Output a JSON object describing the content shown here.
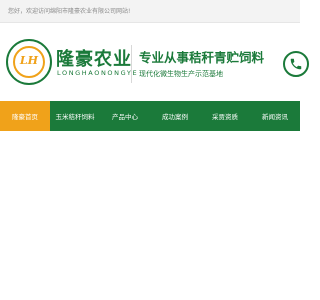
{
  "topbar": {
    "welcome": "您好，欢迎访问绵阳市隆豪农业有限公司网站!"
  },
  "brand": {
    "name_cn": "隆豪农业",
    "name_en": "LONGHAONONGYE",
    "logo_mark": "LH"
  },
  "slogan": {
    "main": "专业从事秸秆青贮饲料",
    "sub": "现代化微生物生产示范基地"
  },
  "nav": {
    "items": [
      {
        "label": "隆豪首页",
        "active": true
      },
      {
        "label": "玉米秸秆饲料",
        "active": false
      },
      {
        "label": "产品中心",
        "active": false
      },
      {
        "label": "成功案例",
        "active": false
      },
      {
        "label": "采贾资质",
        "active": false
      },
      {
        "label": "新闻资讯",
        "active": false
      }
    ]
  },
  "colors": {
    "brand_green": "#1b7a3a",
    "accent_orange": "#f0a21a"
  },
  "icons": {
    "phone": "phone-icon"
  }
}
